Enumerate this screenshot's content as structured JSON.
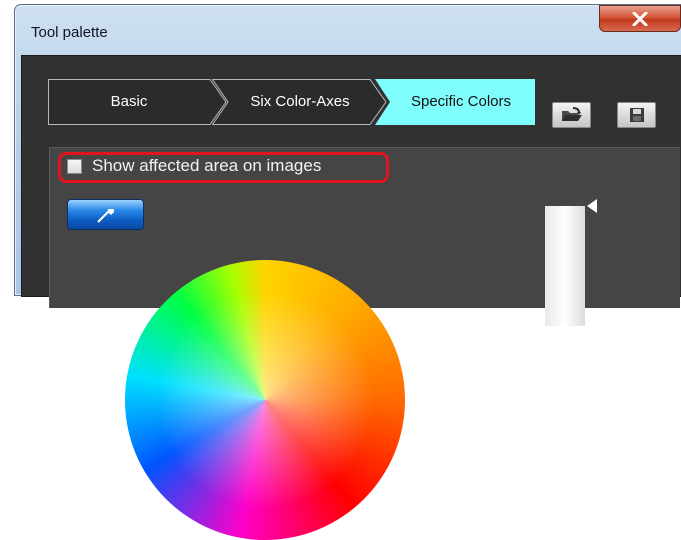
{
  "window": {
    "title": "Tool palette",
    "close_glyph": "X"
  },
  "tabs": [
    {
      "label": "Basic",
      "active": false
    },
    {
      "label": "Six Color-Axes",
      "active": false
    },
    {
      "label": "Specific Colors",
      "active": true
    }
  ],
  "toolbar": {
    "open_icon": "folder-open-icon",
    "save_icon": "save-icon"
  },
  "panel": {
    "checkbox_label": "Show affected area on images",
    "checkbox_checked": false,
    "dropper_icon": "eyedropper-icon"
  },
  "colors": {
    "active_tab": "#7ffdfd",
    "inactive_tab": "#2b2b2b",
    "highlight": "#e0141c",
    "background": "#313131"
  }
}
